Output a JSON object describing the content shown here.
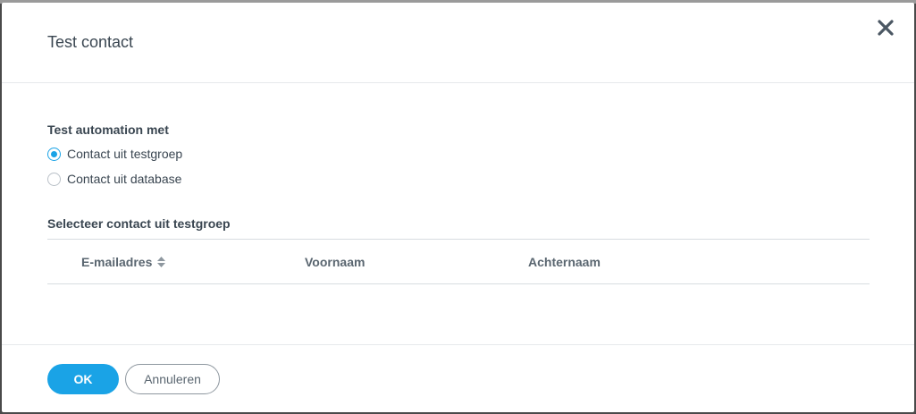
{
  "dialog": {
    "title": "Test contact",
    "close_icon": "close-icon"
  },
  "test_with": {
    "label": "Test automation met",
    "options": [
      {
        "label": "Contact uit testgroep",
        "checked": true
      },
      {
        "label": "Contact uit database",
        "checked": false
      }
    ]
  },
  "contact_table": {
    "label": "Selecteer contact uit testgroep",
    "columns": [
      "E-mailadres",
      "Voornaam",
      "Achternaam"
    ],
    "sort_icon": "sort-icon",
    "rows": []
  },
  "footer": {
    "ok_label": "OK",
    "cancel_label": "Annuleren"
  },
  "colors": {
    "accent": "#1aa3e6",
    "text": "#3a4651",
    "muted": "#5a6670",
    "divider": "#d7dce0"
  }
}
